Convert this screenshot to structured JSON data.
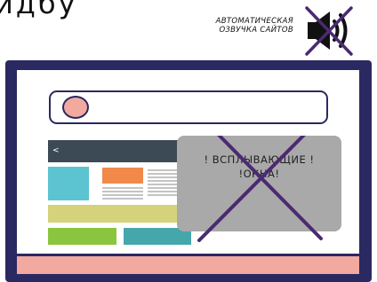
{
  "top_partial_text": "идбу",
  "voice_caption": {
    "line1": "АВТОМАТИЧЕСКАЯ",
    "line2": "ОЗВУЧКА САЙТОВ"
  },
  "icons": {
    "muted_speaker": "speaker-muted-icon",
    "back_chevron": "chevron-left-icon"
  },
  "site": {
    "back_label": "<"
  },
  "popup": {
    "line1": "! ВСПЛЫВАЮЩИЕ !",
    "line2": "!ОКНА!"
  },
  "colors": {
    "monitor_frame": "#2a2961",
    "accent_pink": "#f1a9a0",
    "site_header": "#3c4a56",
    "teal": "#5bc4d0",
    "orange": "#f0894a",
    "olive": "#d4d27a",
    "green": "#8bc540",
    "dark_teal": "#45a7ac",
    "popup_gray": "#a9a9a9",
    "cross_purple": "#4b2a72"
  }
}
